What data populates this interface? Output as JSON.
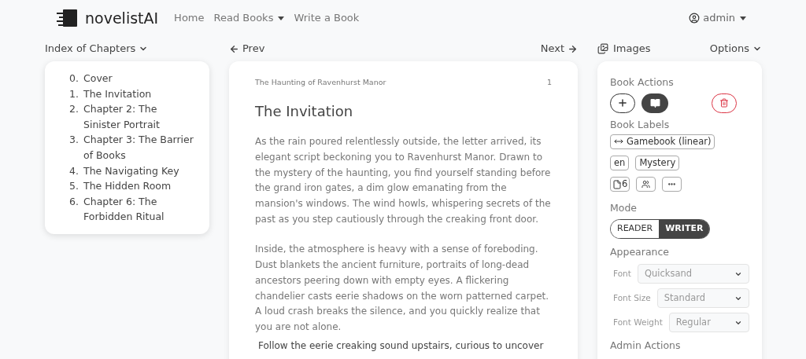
{
  "navbar": {
    "brand": "novelistAI",
    "links": [
      {
        "label": "Home",
        "dropdown": false
      },
      {
        "label": "Read Books",
        "dropdown": true
      },
      {
        "label": "Write a Book",
        "dropdown": false
      }
    ],
    "user": "admin"
  },
  "toolbar": {
    "index_label": "Index of Chapters",
    "prev": "Prev",
    "next": "Next",
    "images": "Images",
    "options": "Options"
  },
  "chapters": [
    {
      "number": "0.",
      "title": "Cover"
    },
    {
      "number": "1.",
      "title": "The Invitation"
    },
    {
      "number": "2.",
      "title": "Chapter 2: The Sinister Portrait"
    },
    {
      "number": "3.",
      "title": "Chapter 3: The Barrier of Books"
    },
    {
      "number": "4.",
      "title": "The Navigating Key"
    },
    {
      "number": "5.",
      "title": "The Hidden Room"
    },
    {
      "number": "6.",
      "title": "Chapter 6: The Forbidden Ritual"
    }
  ],
  "page": {
    "book_title": "The Haunting of Ravenhurst Manor",
    "page_number": "1",
    "chapter_title": "The Invitation",
    "paragraphs": [
      "As the rain poured relentlessly outside, the letter arrived, its elegant script beckoning you to Ravenhurst Manor. Drawn to the mystery of the haunting, you find yourself standing before the grand iron gates, a dim glow emanating from the mansion's windows. The wind howls, whispering secrets of the past as you step cautiously through the creaking front door.",
      "Inside, the atmosphere is heavy with a sense of foreboding. Dust blankets the ancient furniture, portraits of long-dead ancestors peering down with empty eyes. A flickering chandelier casts eerie shadows on the worn patterned carpet. A loud crash breaks the silence, and you quickly realize that you are not alone."
    ],
    "choice": "Follow the eerie creaking sound upstairs, curious to uncover"
  },
  "sidebar": {
    "book_actions_heading": "Book Actions",
    "book_labels_heading": "Book Labels",
    "type_label": "Gamebook (linear)",
    "language": "en",
    "genre": "Mystery",
    "page_count": "6",
    "mode_heading": "Mode",
    "modes": [
      {
        "label": "READER",
        "selected": false
      },
      {
        "label": "WRITER",
        "selected": true
      }
    ],
    "appearance_heading": "Appearance",
    "settings": [
      {
        "label": "Font",
        "value": "Quicksand"
      },
      {
        "label": "Font Size",
        "value": "Standard"
      },
      {
        "label": "Font Weight",
        "value": "Regular"
      }
    ],
    "admin_heading": "Admin Actions"
  }
}
